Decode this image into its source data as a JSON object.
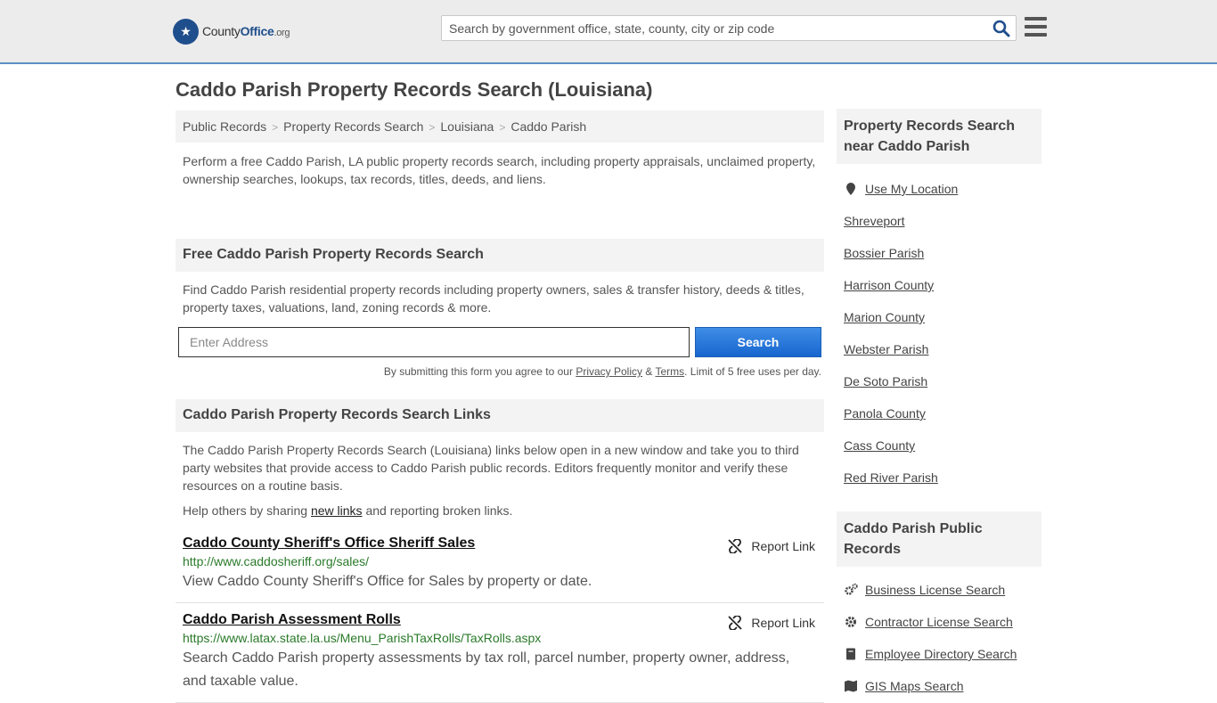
{
  "header": {
    "logo_word1": "County",
    "logo_word2": "Office",
    "logo_tld": ".org",
    "search_placeholder": "Search by government office, state, county, city or zip code"
  },
  "page_title": "Caddo Parish Property Records Search (Louisiana)",
  "breadcrumb": [
    "Public Records",
    "Property Records Search",
    "Louisiana",
    "Caddo Parish"
  ],
  "breadcrumb_sep": ">",
  "intro": "Perform a free Caddo Parish, LA public property records search, including property appraisals, unclaimed property, ownership searches, lookups, tax records, titles, deeds, and liens.",
  "free_search": {
    "heading": "Free Caddo Parish Property Records Search",
    "text": "Find Caddo Parish residential property records including property owners, sales & transfer history, deeds & titles, property taxes, valuations, land, zoning records & more.",
    "input_placeholder": "Enter Address",
    "button_label": "Search",
    "note_prefix": "By submitting this form you agree to our ",
    "privacy_label": "Privacy Policy",
    "note_amp": " & ",
    "terms_label": "Terms",
    "note_suffix": ". Limit of 5 free uses per day."
  },
  "links_section": {
    "heading": "Caddo Parish Property Records Search Links",
    "text": "The Caddo Parish Property Records Search (Louisiana) links below open in a new window and take you to third party websites that provide access to Caddo Parish public records. Editors frequently monitor and verify these resources on a routine basis.",
    "help_prefix": "Help others by sharing ",
    "help_link": "new links",
    "help_suffix": " and reporting broken links."
  },
  "results": [
    {
      "title": "Caddo County Sheriff's Office Sheriff Sales",
      "url": "http://www.caddosheriff.org/sales/",
      "desc": "View Caddo County Sheriff's Office for Sales by property or date.",
      "report": "Report Link"
    },
    {
      "title": "Caddo Parish Assessment Rolls",
      "url": "https://www.latax.state.la.us/Menu_ParishTaxRolls/TaxRolls.aspx",
      "desc": "Search Caddo Parish property assessments by tax roll, parcel number, property owner, address, and taxable value.",
      "report": "Report Link"
    }
  ],
  "sidebar": {
    "nearby_heading": "Property Records Search near Caddo Parish",
    "use_location": "Use My Location",
    "nearby": [
      "Shreveport",
      "Bossier Parish",
      "Harrison County",
      "Marion County",
      "Webster Parish",
      "De Soto Parish",
      "Panola County",
      "Cass County",
      "Red River Parish"
    ],
    "public_heading": "Caddo Parish Public Records",
    "public": [
      {
        "label": "Business License Search",
        "icon": "gears-icon"
      },
      {
        "label": "Contractor License Search",
        "icon": "gear-icon"
      },
      {
        "label": "Employee Directory Search",
        "icon": "book-icon"
      },
      {
        "label": "GIS Maps Search",
        "icon": "map-icon"
      }
    ]
  }
}
